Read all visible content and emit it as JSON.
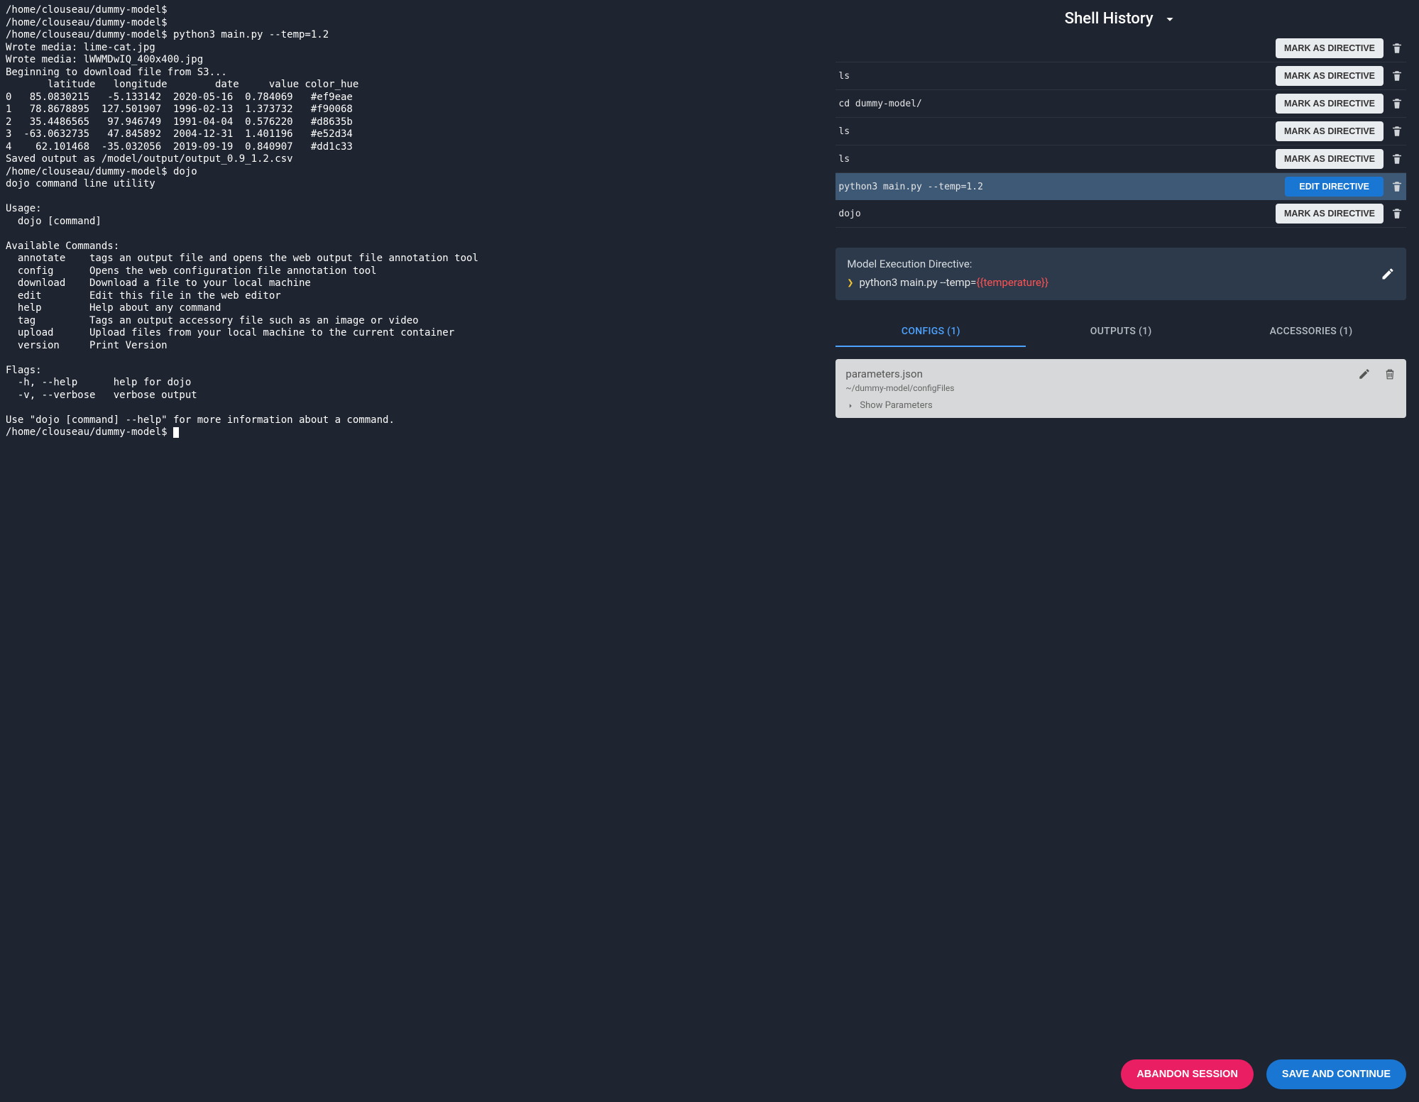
{
  "terminal": {
    "lines": [
      "/home/clouseau/dummy-model$",
      "/home/clouseau/dummy-model$",
      "/home/clouseau/dummy-model$ python3 main.py --temp=1.2",
      "Wrote media: lime-cat.jpg",
      "Wrote media: lWWMDwIQ_400x400.jpg",
      "Beginning to download file from S3...",
      "       latitude   longitude        date     value color_hue",
      "0   85.0830215   -5.133142  2020-05-16  0.784069   #ef9eae",
      "1   78.8678895  127.501907  1996-02-13  1.373732   #f90068",
      "2   35.4486565   97.946749  1991-04-04  0.576220   #d8635b",
      "3  -63.0632735   47.845892  2004-12-31  1.401196   #e52d34",
      "4    62.101468  -35.032056  2019-09-19  0.840907   #dd1c33",
      "Saved output as /model/output/output_0.9_1.2.csv",
      "/home/clouseau/dummy-model$ dojo",
      "dojo command line utility",
      "",
      "Usage:",
      "  dojo [command]",
      "",
      "Available Commands:",
      "  annotate    tags an output file and opens the web output file annotation tool",
      "  config      Opens the web configuration file annotation tool",
      "  download    Download a file to your local machine",
      "  edit        Edit this file in the web editor",
      "  help        Help about any command",
      "  tag         Tags an output accessory file such as an image or video",
      "  upload      Upload files from your local machine to the current container",
      "  version     Print Version",
      "",
      "Flags:",
      "  -h, --help      help for dojo",
      "  -v, --verbose   verbose output",
      "",
      "Use \"dojo [command] --help\" for more information about a command.",
      "/home/clouseau/dummy-model$ "
    ]
  },
  "panel": {
    "title": "Shell History",
    "mark_label": "MARK AS DIRECTIVE",
    "edit_label": "EDIT DIRECTIVE",
    "history": [
      {
        "cmd": "",
        "selected": false,
        "button": "mark",
        "partial": true
      },
      {
        "cmd": "ls",
        "selected": false,
        "button": "mark"
      },
      {
        "cmd": "cd dummy-model/",
        "selected": false,
        "button": "mark"
      },
      {
        "cmd": "ls",
        "selected": false,
        "button": "mark"
      },
      {
        "cmd": "ls",
        "selected": false,
        "button": "mark"
      },
      {
        "cmd": "python3 main.py --temp=1.2",
        "selected": true,
        "button": "edit"
      },
      {
        "cmd": "dojo",
        "selected": false,
        "button": "mark"
      }
    ],
    "directive": {
      "label": "Model Execution Directive:",
      "prefix": "python3 main.py --temp=",
      "template": "{{temperature}}"
    },
    "tabs": [
      {
        "label": "CONFIGS (1)",
        "active": true
      },
      {
        "label": "OUTPUTS (1)",
        "active": false
      },
      {
        "label": "ACCESSORIES (1)",
        "active": false
      }
    ],
    "config": {
      "title": "parameters.json",
      "path": "~/dummy-model/configFiles",
      "show_params": "Show Parameters"
    },
    "footer": {
      "abandon": "ABANDON SESSION",
      "save": "SAVE AND CONTINUE"
    }
  }
}
